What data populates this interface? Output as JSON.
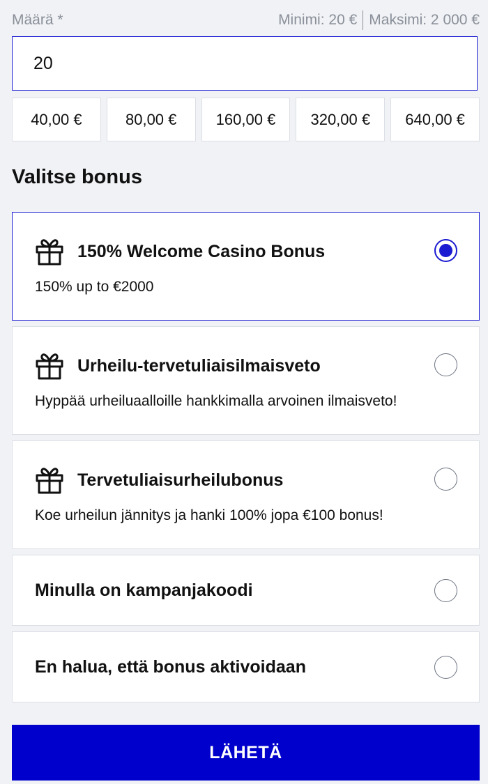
{
  "amount": {
    "label": "Määrä *",
    "min_label": "Minimi: 20 €",
    "max_label": "Maksimi: 2 000 €",
    "value": "20",
    "presets": [
      "40,00 €",
      "80,00 €",
      "160,00 €",
      "320,00 €",
      "640,00 €"
    ]
  },
  "bonus": {
    "section_title": "Valitse bonus",
    "options": [
      {
        "title": "150% Welcome Casino Bonus",
        "description": "150% up to €2000",
        "icon": "gift-icon",
        "selected": true
      },
      {
        "title": "Urheilu-tervetuliaisilmaisveto",
        "description": "Hyppää urheiluaalloille hankkimalla arvoinen ilmaisveto!",
        "icon": "gift-icon",
        "selected": false
      },
      {
        "title": "Tervetuliaisurheilubonus",
        "description": "Koe urheilun jännitys ja hanki 100% jopa €100 bonus!",
        "icon": "gift-icon",
        "selected": false
      },
      {
        "title": "Minulla on kampanjakoodi",
        "selected": false
      },
      {
        "title": "En halua, että bonus aktivoidaan",
        "selected": false
      }
    ]
  },
  "submit_label": "LÄHETÄ",
  "colors": {
    "accent": "#0000cc",
    "background": "#f0f2f5",
    "muted_text": "#8a8f99"
  }
}
